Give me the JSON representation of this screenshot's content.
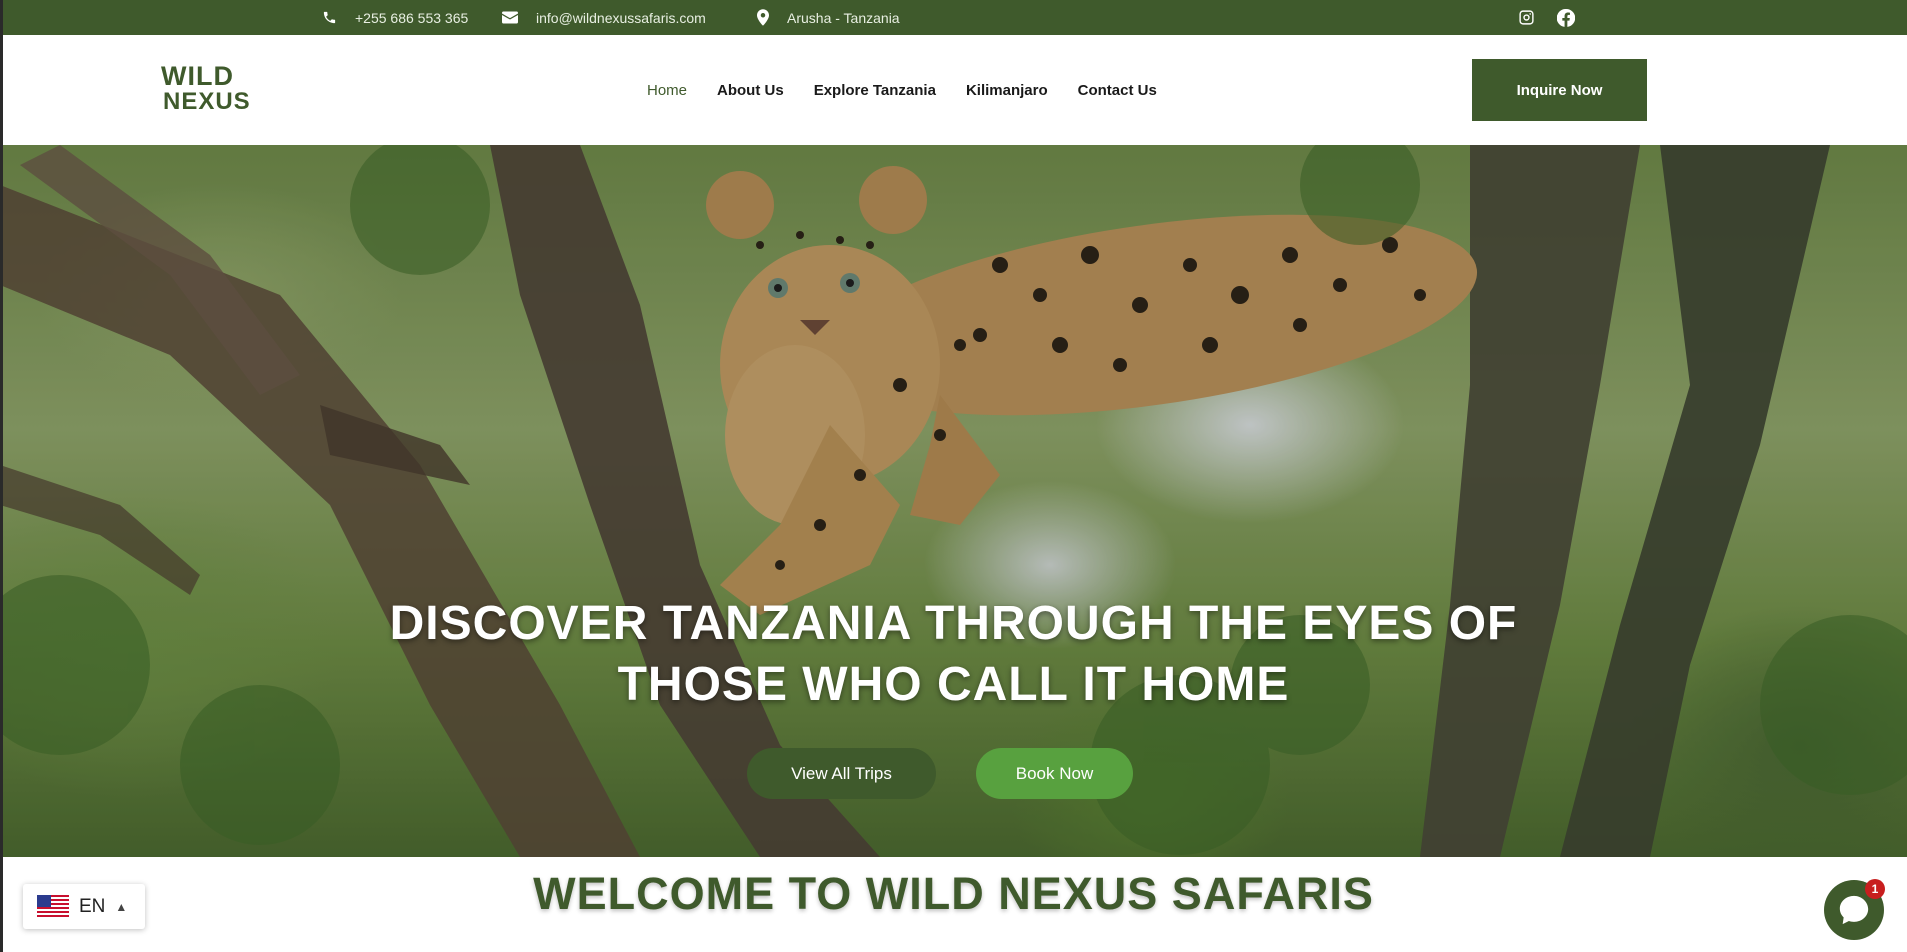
{
  "topbar": {
    "phone": "+255 686 553 365",
    "email": "info@wildnexussafaris.com",
    "location": "Arusha - Tanzania",
    "socials": [
      "instagram-icon",
      "facebook-icon"
    ]
  },
  "header": {
    "logo_line1": "WILD",
    "logo_line2": "NEXUS",
    "nav": [
      "Home",
      "About Us",
      "Explore Tanzania",
      "Kilimanjaro",
      "Contact Us"
    ],
    "active_nav": "Home",
    "cta": "Inquire Now"
  },
  "hero": {
    "title_line1": "DISCOVER TANZANIA THROUGH THE EYES OF",
    "title_line2": "THOSE WHO CALL IT HOME",
    "btn_trips": "View All Trips",
    "btn_book": "Book Now"
  },
  "welcome": {
    "heading": "WELCOME TO WILD NEXUS SAFARIS"
  },
  "language": {
    "code": "EN"
  },
  "chat": {
    "badge_count": "1"
  },
  "colors": {
    "brand_green": "#3f5a2c",
    "accent_green": "#58a13f",
    "badge_red": "#c81e1e"
  }
}
